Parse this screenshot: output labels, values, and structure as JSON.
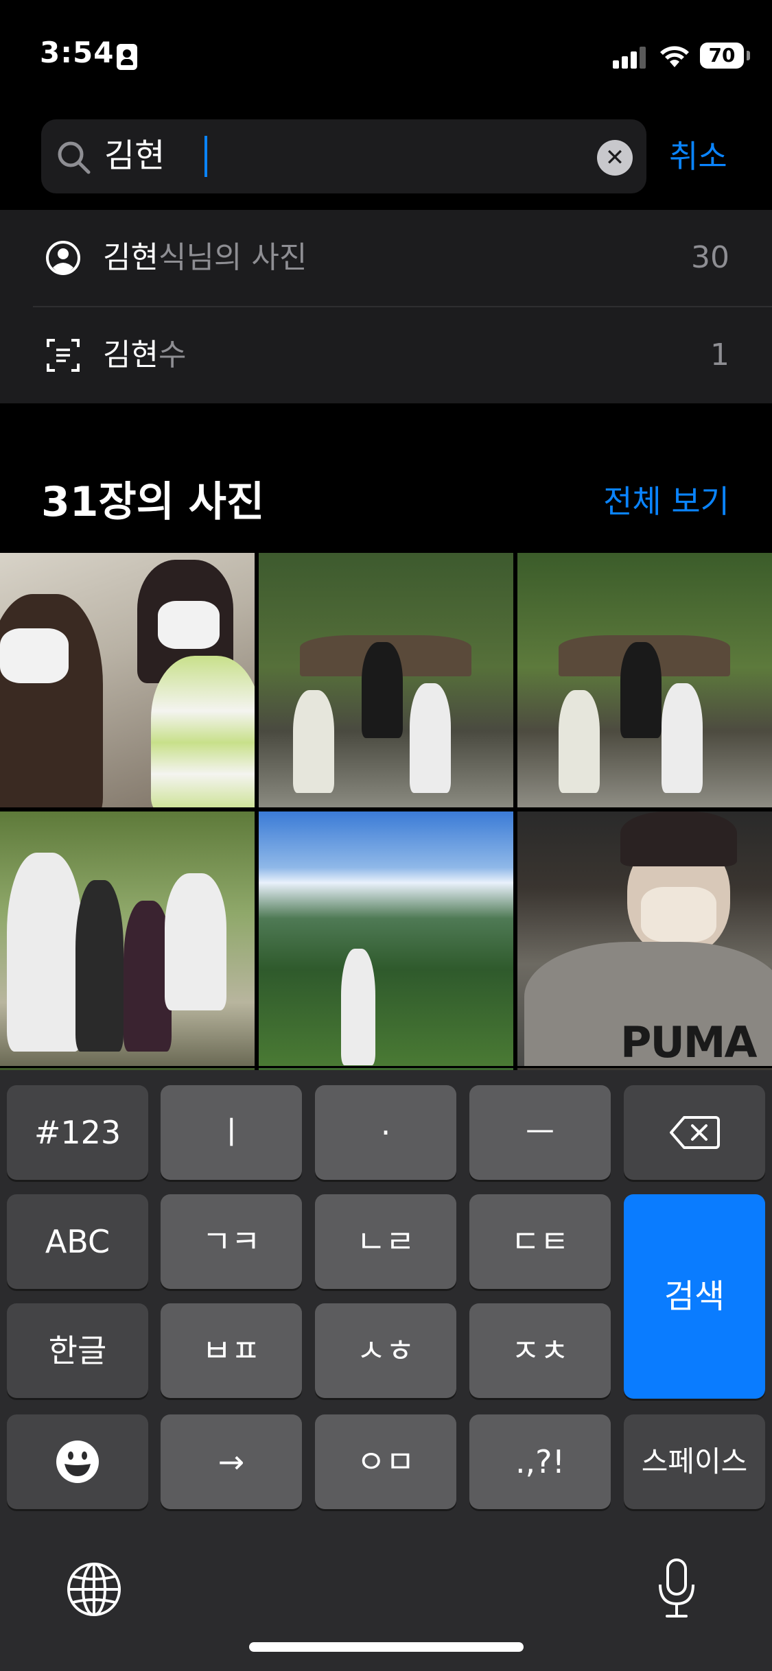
{
  "status_bar": {
    "time": "3:54",
    "battery": "70"
  },
  "search": {
    "query": "김현",
    "cancel_label": "취소"
  },
  "suggestions": [
    {
      "icon": "person-circle-icon",
      "highlight": "김현",
      "rest": "식님의 사진",
      "count": "30"
    },
    {
      "icon": "text-scan-icon",
      "highlight": "김현",
      "rest": "수",
      "count": "1"
    }
  ],
  "results": {
    "title": "31장의 사진",
    "see_all_label": "전체 보기",
    "photo_text": "PUMA"
  },
  "keyboard": {
    "row1": [
      "#123",
      "ㅣ",
      "·",
      "ㅡ",
      "backspace-icon"
    ],
    "row2": [
      "ABC",
      "ㄱㅋ",
      "ㄴㄹ",
      "ㄷㅌ"
    ],
    "row3": [
      "한글",
      "ㅂㅍ",
      "ㅅㅎ",
      "ㅈㅊ"
    ],
    "row4": [
      "emoji-icon",
      "→",
      "ㅇㅁ",
      ".,?!",
      "스페이스"
    ],
    "search_label": "검색",
    "bottom": [
      "globe-icon",
      "microphone-icon"
    ]
  },
  "colors": {
    "accent": "#0a84ff",
    "background": "#000000",
    "panel": "#1c1c1e"
  }
}
